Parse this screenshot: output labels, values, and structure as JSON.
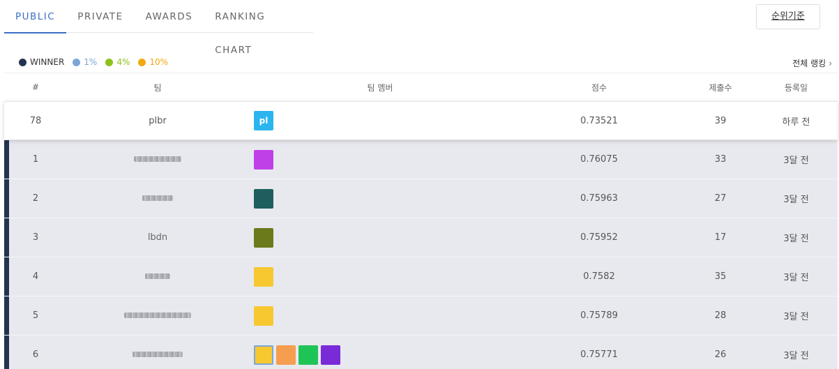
{
  "tabs": [
    {
      "label": "PUBLIC",
      "active": true
    },
    {
      "label": "PRIVATE",
      "active": false
    },
    {
      "label": "AWARDS",
      "active": false
    },
    {
      "label": "RANKING CHART",
      "active": false
    }
  ],
  "rank_criteria_button": "순위기준",
  "legend": [
    {
      "label": "WINNER",
      "color": "#243450",
      "text_color": "#333333"
    },
    {
      "label": "1%",
      "color": "#7ba7d7",
      "text_color": "#7ba7d7"
    },
    {
      "label": "4%",
      "color": "#8cc21b",
      "text_color": "#8cc21b"
    },
    {
      "label": "10%",
      "color": "#f2a90f",
      "text_color": "#f2a90f"
    }
  ],
  "all_ranking_link": "전체 랭킹",
  "columns": {
    "rank": "#",
    "team": "팀",
    "members": "팀 멤버",
    "score": "점수",
    "submissions": "제출수",
    "date": "등록일"
  },
  "my_team": {
    "rank": "78",
    "team": "plbr",
    "avatar_text": "pl",
    "avatar_color": "#2bb5ef",
    "score": "0.73521",
    "submissions": "39",
    "date": "하루 전"
  },
  "rows": [
    {
      "rank": "1",
      "score": "0.76075",
      "submissions": "33",
      "date": "3달 전",
      "avatars": [
        {
          "color": "#c040e8"
        }
      ]
    },
    {
      "rank": "2",
      "score": "0.75963",
      "submissions": "27",
      "date": "3달 전",
      "avatars": [
        {
          "color": "#1e5e5e"
        }
      ]
    },
    {
      "rank": "3",
      "team": "lbdn",
      "score": "0.75952",
      "submissions": "17",
      "date": "3달 전",
      "avatars": [
        {
          "color": "#6b7a1a"
        }
      ]
    },
    {
      "rank": "4",
      "score": "0.7582",
      "submissions": "35",
      "date": "3달 전",
      "avatars": [
        {
          "color": "#f7c830"
        }
      ]
    },
    {
      "rank": "5",
      "score": "0.75789",
      "submissions": "28",
      "date": "3달 전",
      "avatars": [
        {
          "color": "#f7c830"
        }
      ]
    },
    {
      "rank": "6",
      "score": "0.75771",
      "submissions": "26",
      "date": "3달 전",
      "avatars": [
        {
          "color": "#f7c830"
        },
        {
          "color": "#f59e50"
        },
        {
          "color": "#1fc457"
        },
        {
          "color": "#7a2bd8"
        }
      ]
    }
  ]
}
